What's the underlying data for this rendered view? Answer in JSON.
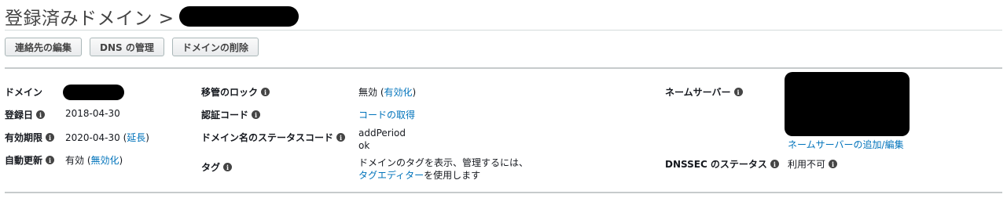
{
  "header": {
    "title": "登録済みドメイン >"
  },
  "actions": {
    "edit_contacts": "連絡先の編集",
    "manage_dns": "DNS の管理",
    "delete_domain": "ドメインの削除"
  },
  "details": {
    "domain": {
      "label": "ドメイン"
    },
    "registered": {
      "label": "登録日",
      "value": "2018-04-30"
    },
    "expiry": {
      "label": "有効期限",
      "value": "2020-04-30",
      "link_prefix": " (",
      "link": "延長",
      "link_suffix": ")"
    },
    "auto_renew": {
      "label": "自動更新",
      "value": "有効",
      "link_prefix": " (",
      "link": "無効化",
      "link_suffix": ")"
    },
    "transfer_lock": {
      "label": "移管のロック",
      "value": "無効",
      "link_prefix": " (",
      "link": "有効化",
      "link_suffix": ")"
    },
    "auth_code": {
      "label": "認証コード",
      "link": "コードの取得"
    },
    "status_code": {
      "label": "ドメイン名のステータスコード",
      "line1": "addPeriod",
      "line2": "ok"
    },
    "tags": {
      "label": "タグ",
      "line1": "ドメインのタグを表示、管理するには、",
      "link": "タグエディター",
      "line2_suffix": "を使用します"
    },
    "name_servers": {
      "label": "ネームサーバー",
      "link": "ネームサーバーの追加/編集"
    },
    "dnssec": {
      "label": "DNSSEC のステータス",
      "value": "利用不可"
    }
  },
  "icons": {
    "info": "info-icon",
    "info_glyph": "i"
  }
}
